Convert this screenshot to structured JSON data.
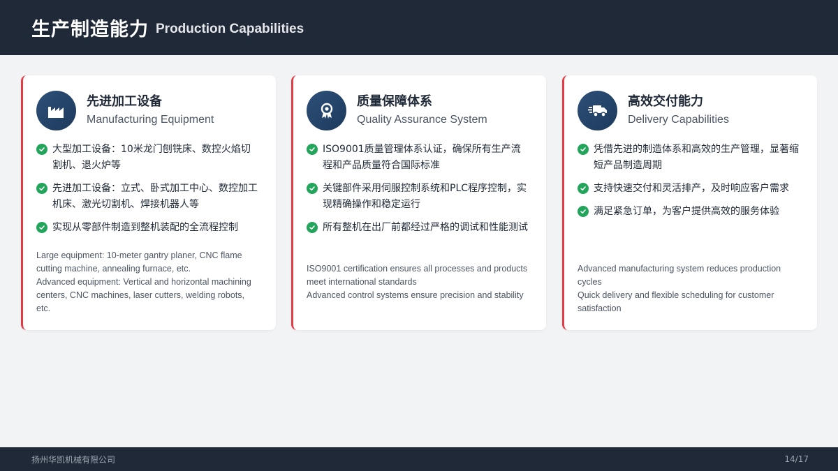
{
  "header": {
    "title_cn": "生产制造能力",
    "title_en": "Production Capabilities"
  },
  "cards": [
    {
      "icon": "factory-icon",
      "title_cn": "先进加工设备",
      "title_en": "Manufacturing Equipment",
      "bullets": [
        "大型加工设备：10米龙门刨铣床、数控火焰切割机、退火炉等",
        "先进加工设备：立式、卧式加工中心、数控加工机床、激光切割机、焊接机器人等",
        "实现从零部件制造到整机装配的全流程控制"
      ],
      "notes": [
        "Large equipment: 10-meter gantry planer, CNC flame cutting machine, annealing furnace, etc.",
        "Advanced equipment: Vertical and horizontal machining centers, CNC machines, laser cutters, welding robots, etc."
      ]
    },
    {
      "icon": "award-icon",
      "title_cn": "质量保障体系",
      "title_en": "Quality Assurance System",
      "bullets": [
        "ISO9001质量管理体系认证，确保所有生产流程和产品质量符合国际标准",
        "关键部件采用伺服控制系统和PLC程序控制，实现精确操作和稳定运行",
        "所有整机在出厂前都经过严格的调试和性能测试"
      ],
      "notes": [
        "ISO9001 certification ensures all processes and products meet international standards",
        "Advanced control systems ensure precision and stability"
      ]
    },
    {
      "icon": "truck-fast-icon",
      "title_cn": "高效交付能力",
      "title_en": "Delivery Capabilities",
      "bullets": [
        "凭借先进的制造体系和高效的生产管理，显著缩短产品制造周期",
        "支持快速交付和灵活排产，及时响应客户需求",
        "满足紧急订单，为客户提供高效的服务体验"
      ],
      "notes": [
        "Advanced manufacturing system reduces production cycles",
        "Quick delivery and flexible scheduling for customer satisfaction"
      ]
    }
  ],
  "footer": {
    "company": "扬州华凯机械有限公司",
    "page": "14/17"
  },
  "colors": {
    "header_bg": "#1f2937",
    "accent_red": "#e23c47",
    "check_green": "#22a55b",
    "icon_blue": "#2d4f78"
  }
}
